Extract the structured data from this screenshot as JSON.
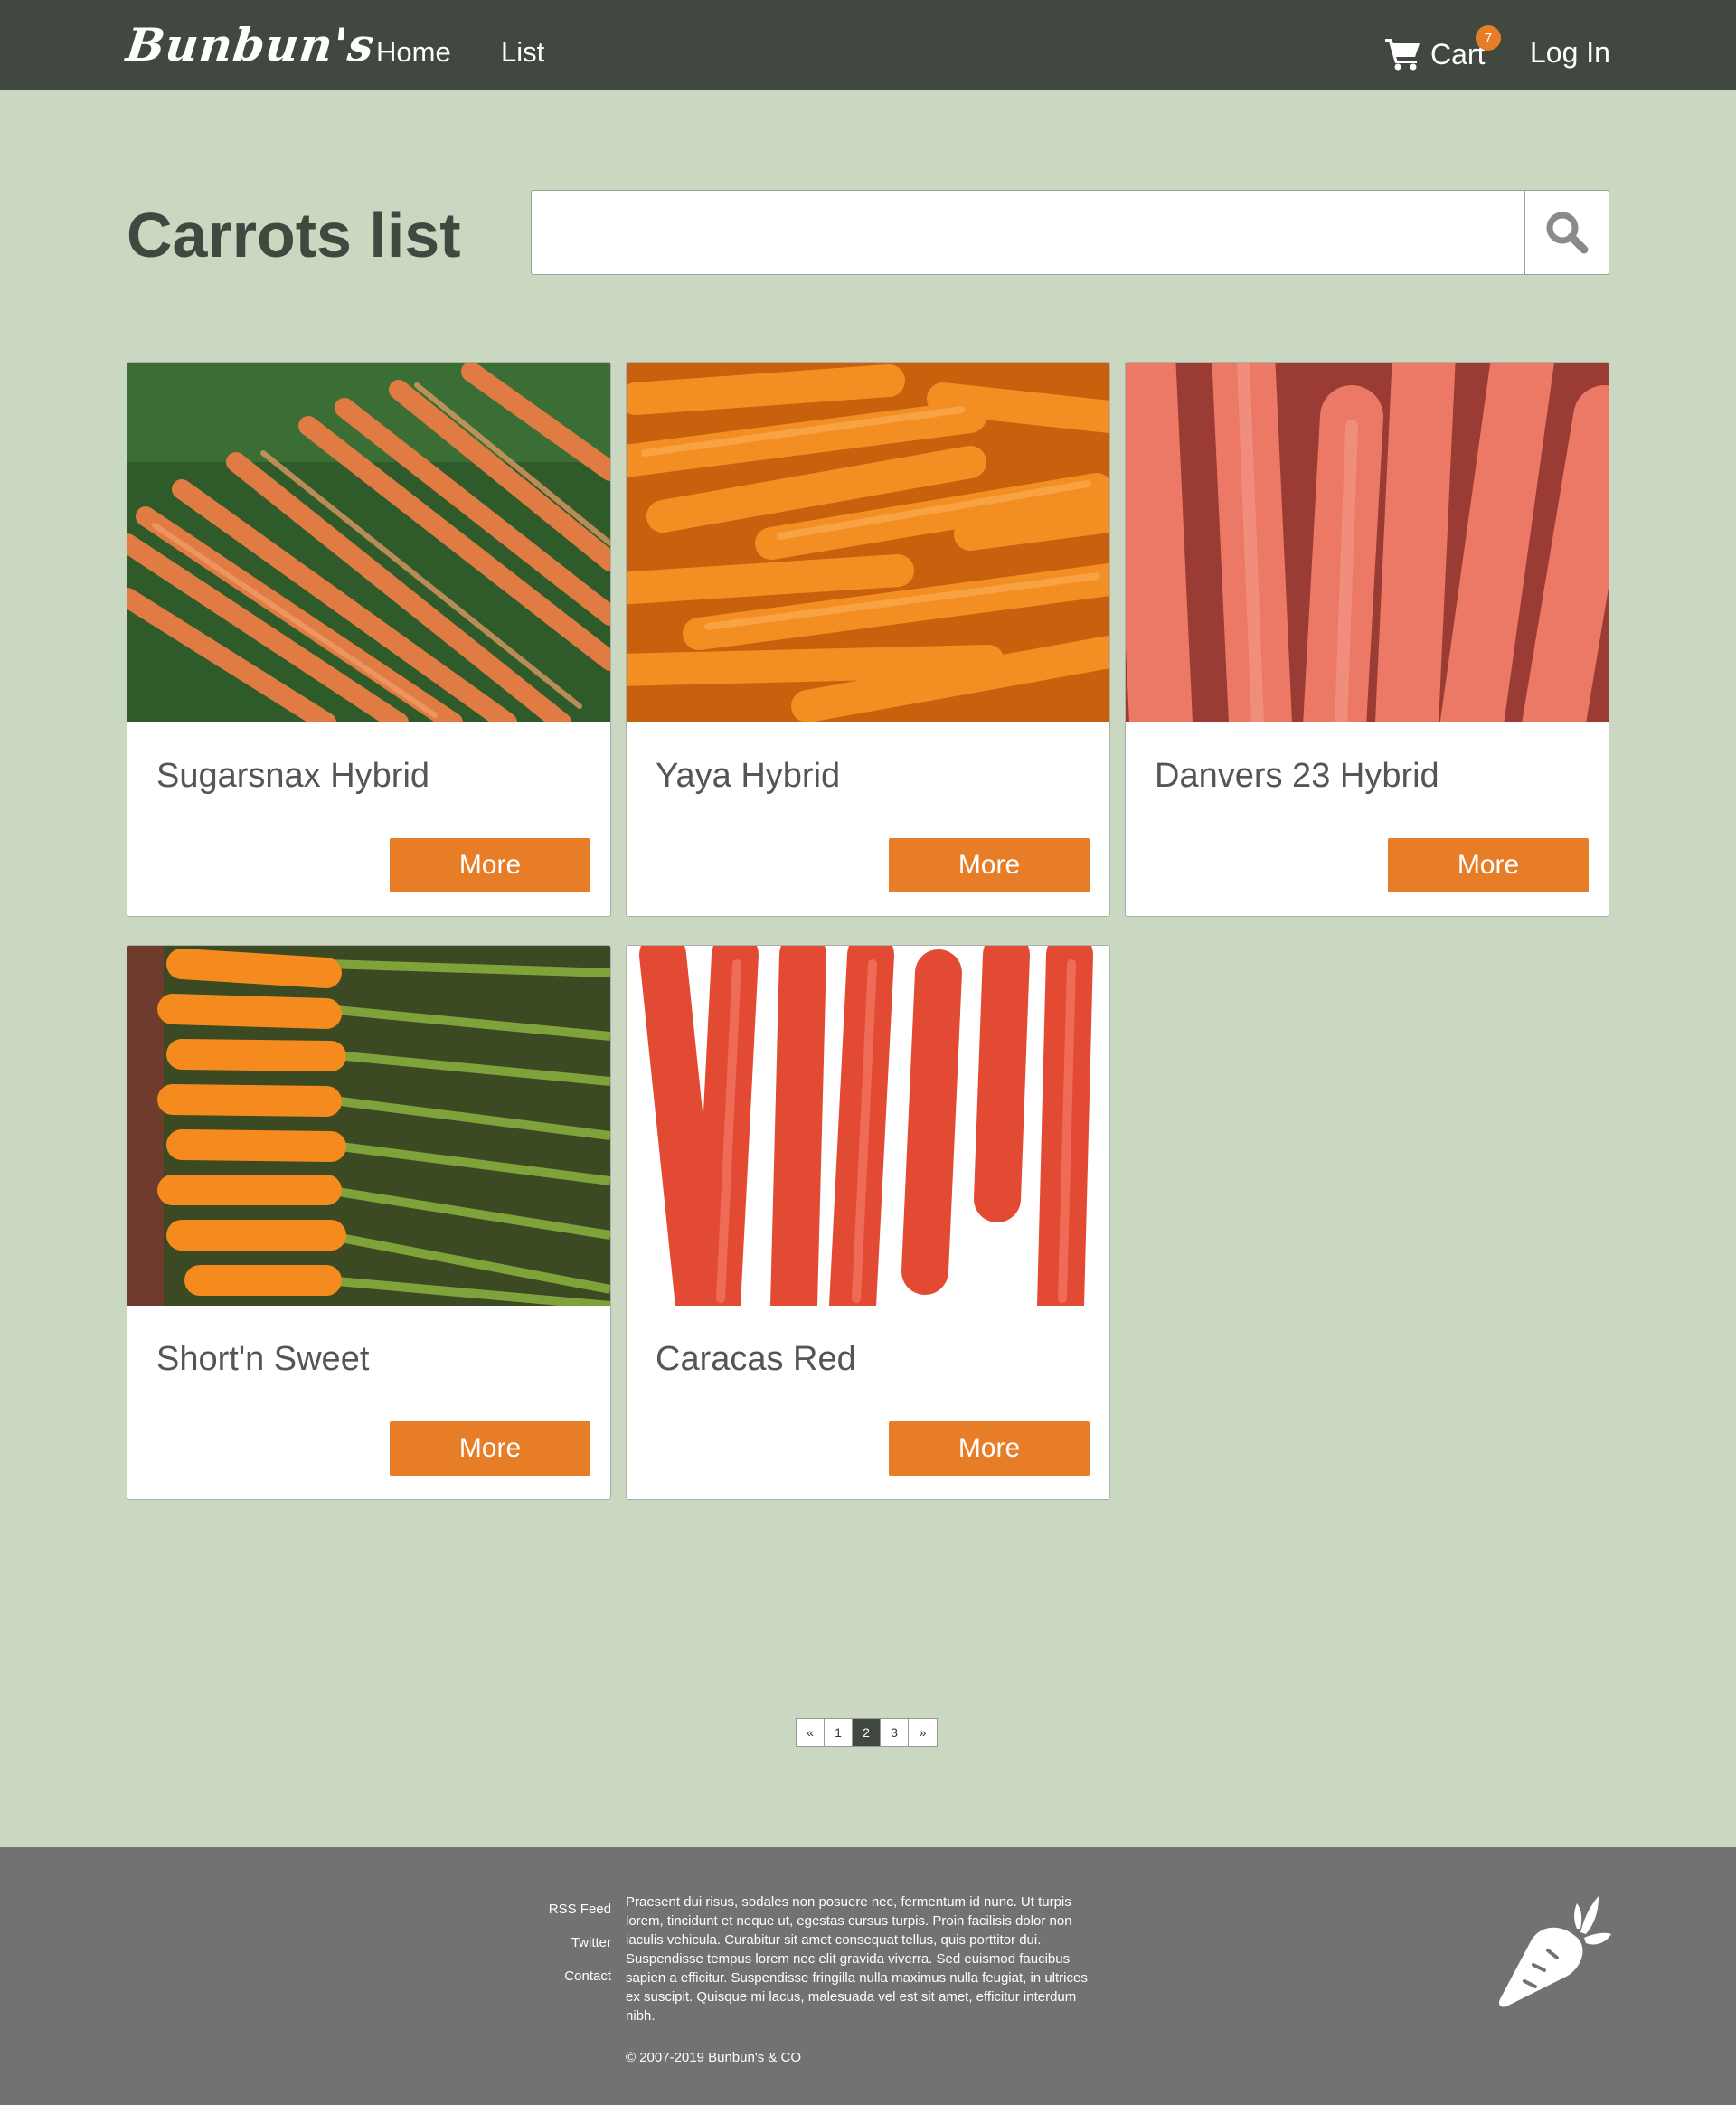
{
  "nav": {
    "brand": "Bunbun's",
    "home": "Home",
    "list": "List",
    "cart_label": "Cart",
    "cart_count": "7",
    "login": "Log In",
    "cart_icon": "shopping-cart-icon"
  },
  "header": {
    "title": "Carrots list",
    "search_placeholder": "",
    "search_icon": "search-icon"
  },
  "products": [
    {
      "name": "Sugarsnax Hybrid",
      "button": "More"
    },
    {
      "name": "Yaya Hybrid",
      "button": "More"
    },
    {
      "name": "Danvers 23 Hybrid",
      "button": "More"
    },
    {
      "name": "Short'n Sweet",
      "button": "More"
    },
    {
      "name": "Caracas Red",
      "button": "More"
    }
  ],
  "pagination": {
    "prev": "«",
    "pages": [
      "1",
      "2",
      "3"
    ],
    "current": "2",
    "next": "»"
  },
  "footer": {
    "links": [
      "RSS Feed",
      "Twitter",
      "Contact"
    ],
    "text": "Praesent dui risus, sodales non posuere nec, fermentum id nunc. Ut turpis lorem, tincidunt et neque ut, egestas cursus turpis. Proin facilisis dolor non iaculis vehicula. Curabitur sit amet consequat tellus, quis porttitor dui. Suspendisse tempus lorem nec elit gravida viverra. Sed euismod faucibus sapien a efficitur. Suspendisse fringilla nulla maximus nulla feugiat, in ultrices ex suscipit. Quisque mi lacus, malesuada vel est sit amet, efficitur interdum nibh.",
    "copyright": "© 2007-2019 Bunbun's & CO",
    "logo_icon": "carrot-logo-icon"
  },
  "colors": {
    "navbar": "#404840",
    "background": "#cad8c1",
    "accent": "#e77d26",
    "footer": "#727272"
  }
}
